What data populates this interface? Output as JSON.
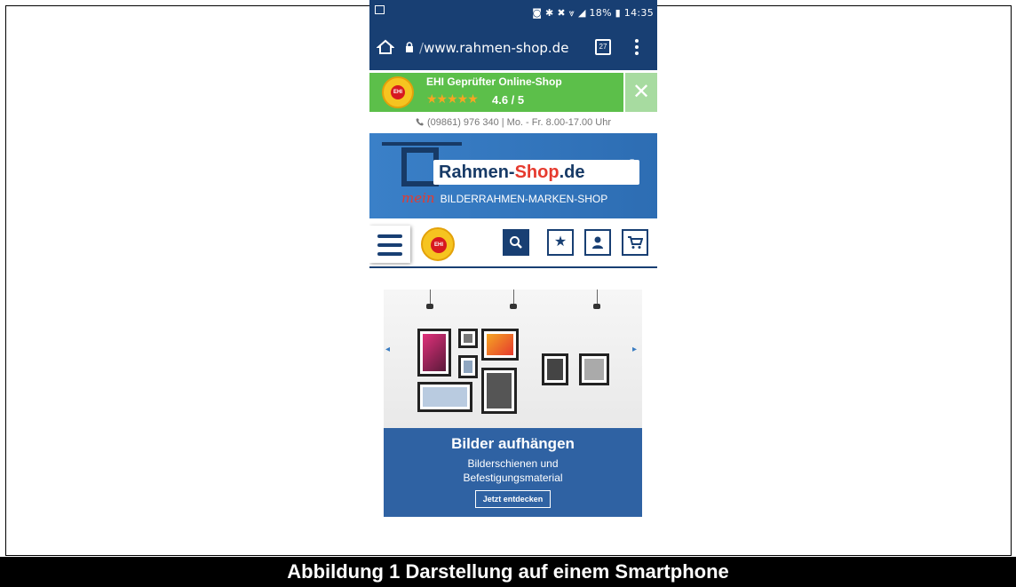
{
  "status_bar": {
    "right_text": "◙ ✱ ✖ ⩔ ◢ 18% ▮ 14:35"
  },
  "browser": {
    "url": "www.rahmen-shop.de",
    "tab_count": "27"
  },
  "ehi_banner": {
    "title": "EHI Geprüfter Online-Shop",
    "stars": "★★★★★",
    "rating": "4.6 / 5",
    "badge_text": "EHI",
    "close_glyph": "✕"
  },
  "contact": {
    "text": "(09861) 976 340 | Mo. - Fr. 8.00-17.00 Uhr"
  },
  "brand": {
    "logo_part1": "Rahmen-",
    "logo_part2": "Shop",
    "logo_part3": ".de",
    "reg": "®",
    "mein": "mein",
    "tagline": "BILDERRAHMEN-MARKEN-SHOP"
  },
  "nav": {
    "seal_text": "EHI",
    "search_glyph": "⚲",
    "star_glyph": "★",
    "user_glyph": "👤",
    "cart_glyph": "🛒"
  },
  "slider": {
    "left_arrow": "◂",
    "right_arrow": "▸",
    "headline": "Bilder aufhängen",
    "subline_1": "Bilderschienen und",
    "subline_2": "Befestigungsmaterial",
    "cta": "Jetzt entdecken"
  },
  "caption": {
    "text": "Abbildung 1 Darstellung auf einem Smartphone"
  },
  "colors": {
    "primary_blue": "#183f73",
    "ehi_green": "#5cbf4a",
    "accent_red": "#e63a2e"
  }
}
